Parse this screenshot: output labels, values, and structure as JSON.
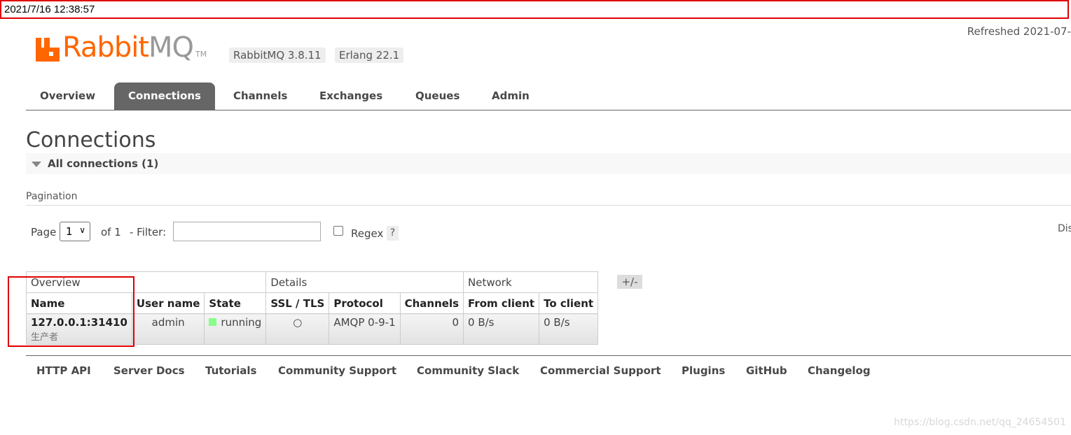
{
  "timestamp": "2021/7/16 12:38:57",
  "logo": {
    "brand": "Rabbit",
    "brand_suffix": "MQ",
    "tm": "TM"
  },
  "versions": {
    "rabbitmq": "RabbitMQ 3.8.11",
    "erlang": "Erlang 22.1"
  },
  "refreshed": "Refreshed 2021-07-",
  "tabs": [
    {
      "label": "Overview",
      "active": false
    },
    {
      "label": "Connections",
      "active": true
    },
    {
      "label": "Channels",
      "active": false
    },
    {
      "label": "Exchanges",
      "active": false
    },
    {
      "label": "Queues",
      "active": false
    },
    {
      "label": "Admin",
      "active": false
    }
  ],
  "page_title": "Connections",
  "section": {
    "label": "All connections (1)"
  },
  "pagination": {
    "label": "Pagination",
    "page_label": "Page",
    "page_value": "1",
    "of_label": "of 1",
    "filter_label": "- Filter:",
    "filter_value": "",
    "regex_label": "Regex",
    "regex_checked": false,
    "help": "?",
    "right_truncated": "Dis"
  },
  "table": {
    "groups": [
      "Overview",
      "Details",
      "Network"
    ],
    "columns": [
      "Name",
      "User name",
      "State",
      "SSL / TLS",
      "Protocol",
      "Channels",
      "From client",
      "To client"
    ],
    "plus_minus": "+/-",
    "rows": [
      {
        "name": "127.0.0.1:31410",
        "name_sub": "生产者",
        "user": "admin",
        "state": "running",
        "ssl": "○",
        "protocol": "AMQP 0-9-1",
        "channels": "0",
        "from_client": "0 B/s",
        "to_client": "0 B/s"
      }
    ]
  },
  "footer": {
    "links": [
      "HTTP API",
      "Server Docs",
      "Tutorials",
      "Community Support",
      "Community Slack",
      "Commercial Support",
      "Plugins",
      "GitHub",
      "Changelog"
    ]
  },
  "watermark": "https://blog.csdn.net/qq_24654501",
  "colors": {
    "accent_orange": "#ff6600",
    "tab_active": "#666666",
    "state_running": "#88ff88",
    "highlight_red": "#e00000"
  }
}
